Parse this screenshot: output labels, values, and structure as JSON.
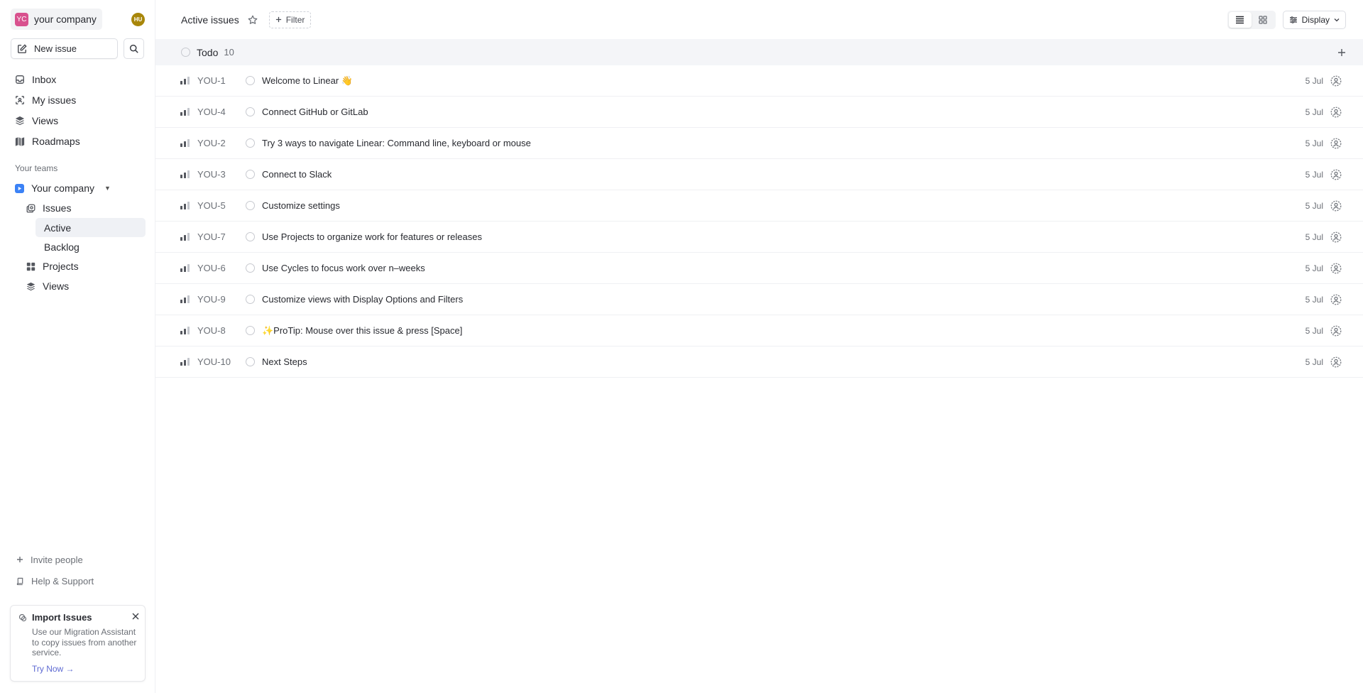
{
  "workspace": {
    "logo_text": "YC",
    "name": "your company",
    "user_initials": "HU"
  },
  "actions": {
    "new_issue_label": "New issue"
  },
  "nav": [
    {
      "label": "Inbox",
      "icon": "inbox-icon"
    },
    {
      "label": "My issues",
      "icon": "my-issues-icon"
    },
    {
      "label": "Views",
      "icon": "layers-icon"
    },
    {
      "label": "Roadmaps",
      "icon": "map-icon"
    }
  ],
  "teams": {
    "section_label": "Your teams",
    "team_name": "Your company",
    "items": {
      "issues": "Issues",
      "active": "Active",
      "backlog": "Backlog",
      "projects": "Projects",
      "views": "Views"
    }
  },
  "bottom": {
    "invite": "Invite people",
    "help": "Help & Support"
  },
  "import_card": {
    "title": "Import Issues",
    "text": "Use our Migration Assistant to copy issues from another service.",
    "link": "Try Now →"
  },
  "header": {
    "title": "Active issues",
    "filter_label": "Filter",
    "display_label": "Display"
  },
  "group": {
    "name": "Todo",
    "count": "10"
  },
  "issues": [
    {
      "id": "YOU-1",
      "title": "Welcome to Linear 👋",
      "date": "5 Jul"
    },
    {
      "id": "YOU-4",
      "title": "Connect GitHub or GitLab",
      "date": "5 Jul"
    },
    {
      "id": "YOU-2",
      "title": "Try 3 ways to navigate Linear: Command line, keyboard or mouse",
      "date": "5 Jul"
    },
    {
      "id": "YOU-3",
      "title": "Connect to Slack",
      "date": "5 Jul"
    },
    {
      "id": "YOU-5",
      "title": "Customize settings",
      "date": "5 Jul"
    },
    {
      "id": "YOU-7",
      "title": "Use Projects to organize work for features or releases",
      "date": "5 Jul"
    },
    {
      "id": "YOU-6",
      "title": "Use Cycles to focus work over n–weeks",
      "date": "5 Jul"
    },
    {
      "id": "YOU-9",
      "title": "Customize views with Display Options and Filters",
      "date": "5 Jul"
    },
    {
      "id": "YOU-8",
      "title": "✨ProTip: Mouse over this issue & press [Space]",
      "date": "5 Jul"
    },
    {
      "id": "YOU-10",
      "title": "Next Steps",
      "date": "5 Jul"
    }
  ],
  "colors": {
    "accent": "#5e6ad2",
    "workspace_logo": "#d8518e",
    "team_icon": "#3b82f6",
    "user_avatar": "#a8860a"
  }
}
